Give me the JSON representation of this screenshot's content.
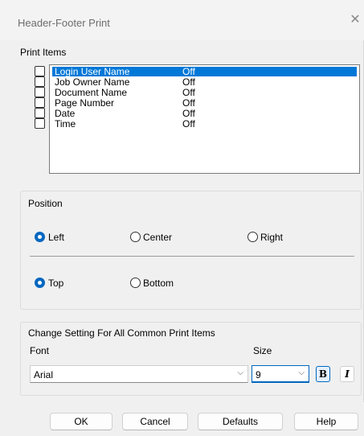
{
  "window": {
    "title": "Header-Footer Print"
  },
  "print_items": {
    "label": "Print Items",
    "rows": [
      {
        "name": "Login User Name",
        "value": "Off",
        "selected": true,
        "checked": false
      },
      {
        "name": "Job Owner Name",
        "value": "Off",
        "selected": false,
        "checked": false
      },
      {
        "name": "Document Name",
        "value": "Off",
        "selected": false,
        "checked": false
      },
      {
        "name": "Page Number",
        "value": "Off",
        "selected": false,
        "checked": false
      },
      {
        "name": "Date",
        "value": "Off",
        "selected": false,
        "checked": false
      },
      {
        "name": "Time",
        "value": "Off",
        "selected": false,
        "checked": false
      }
    ]
  },
  "position": {
    "label": "Position",
    "horizontal": [
      {
        "label": "Left",
        "checked": true
      },
      {
        "label": "Center",
        "checked": false
      },
      {
        "label": "Right",
        "checked": false
      }
    ],
    "vertical": [
      {
        "label": "Top",
        "checked": true
      },
      {
        "label": "Bottom",
        "checked": false
      }
    ]
  },
  "common_settings": {
    "label": "Change Setting For All Common Print Items",
    "font_label": "Font",
    "size_label": "Size",
    "font_value": "Arial",
    "size_value": "9",
    "bold_label": "B",
    "italic_label": "I"
  },
  "buttons": {
    "ok": "OK",
    "cancel": "Cancel",
    "defaults": "Defaults",
    "help": "Help"
  },
  "colors": {
    "selection": "#0078d7",
    "accent": "#0067c0"
  }
}
